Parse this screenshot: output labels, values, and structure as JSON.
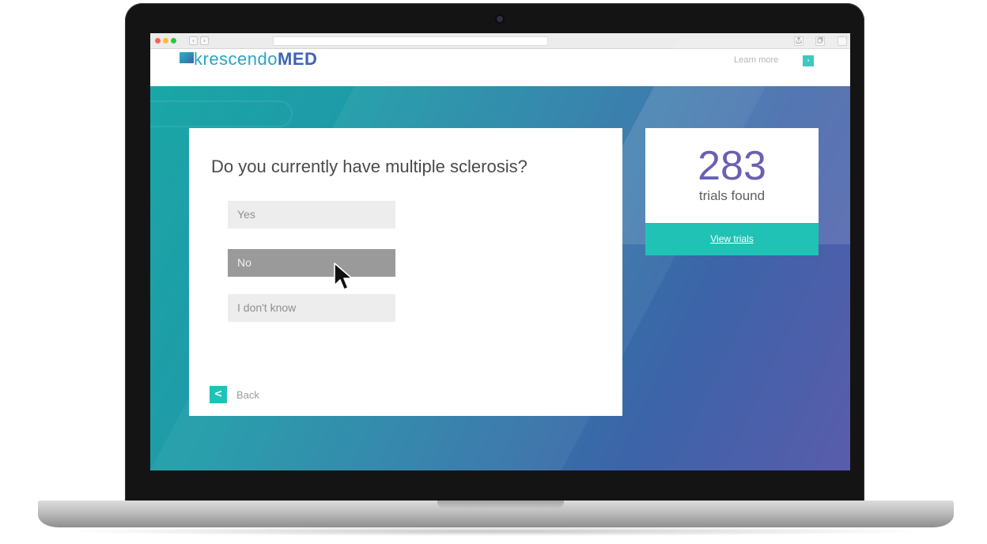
{
  "browser": {
    "back_glyph": "‹",
    "forward_glyph": "›"
  },
  "header": {
    "logo_part1": "krescendo",
    "logo_part2": "MED",
    "learn_more": "Learn more",
    "learn_more_arrow": "›"
  },
  "question": {
    "title": "Do you currently have multiple sclerosis?",
    "options": [
      {
        "label": "Yes",
        "state": "default"
      },
      {
        "label": "No",
        "state": "hovered"
      },
      {
        "label": "I don't know",
        "state": "default"
      }
    ],
    "back_glyph": "<",
    "back_label": "Back"
  },
  "results": {
    "count": "283",
    "label": "trials found",
    "view_button": "View trials"
  },
  "colors": {
    "accent_teal": "#21c2b6",
    "count_purple": "#6a60b4",
    "hero_start": "#1aa6a6",
    "hero_end": "#5a5cab"
  }
}
